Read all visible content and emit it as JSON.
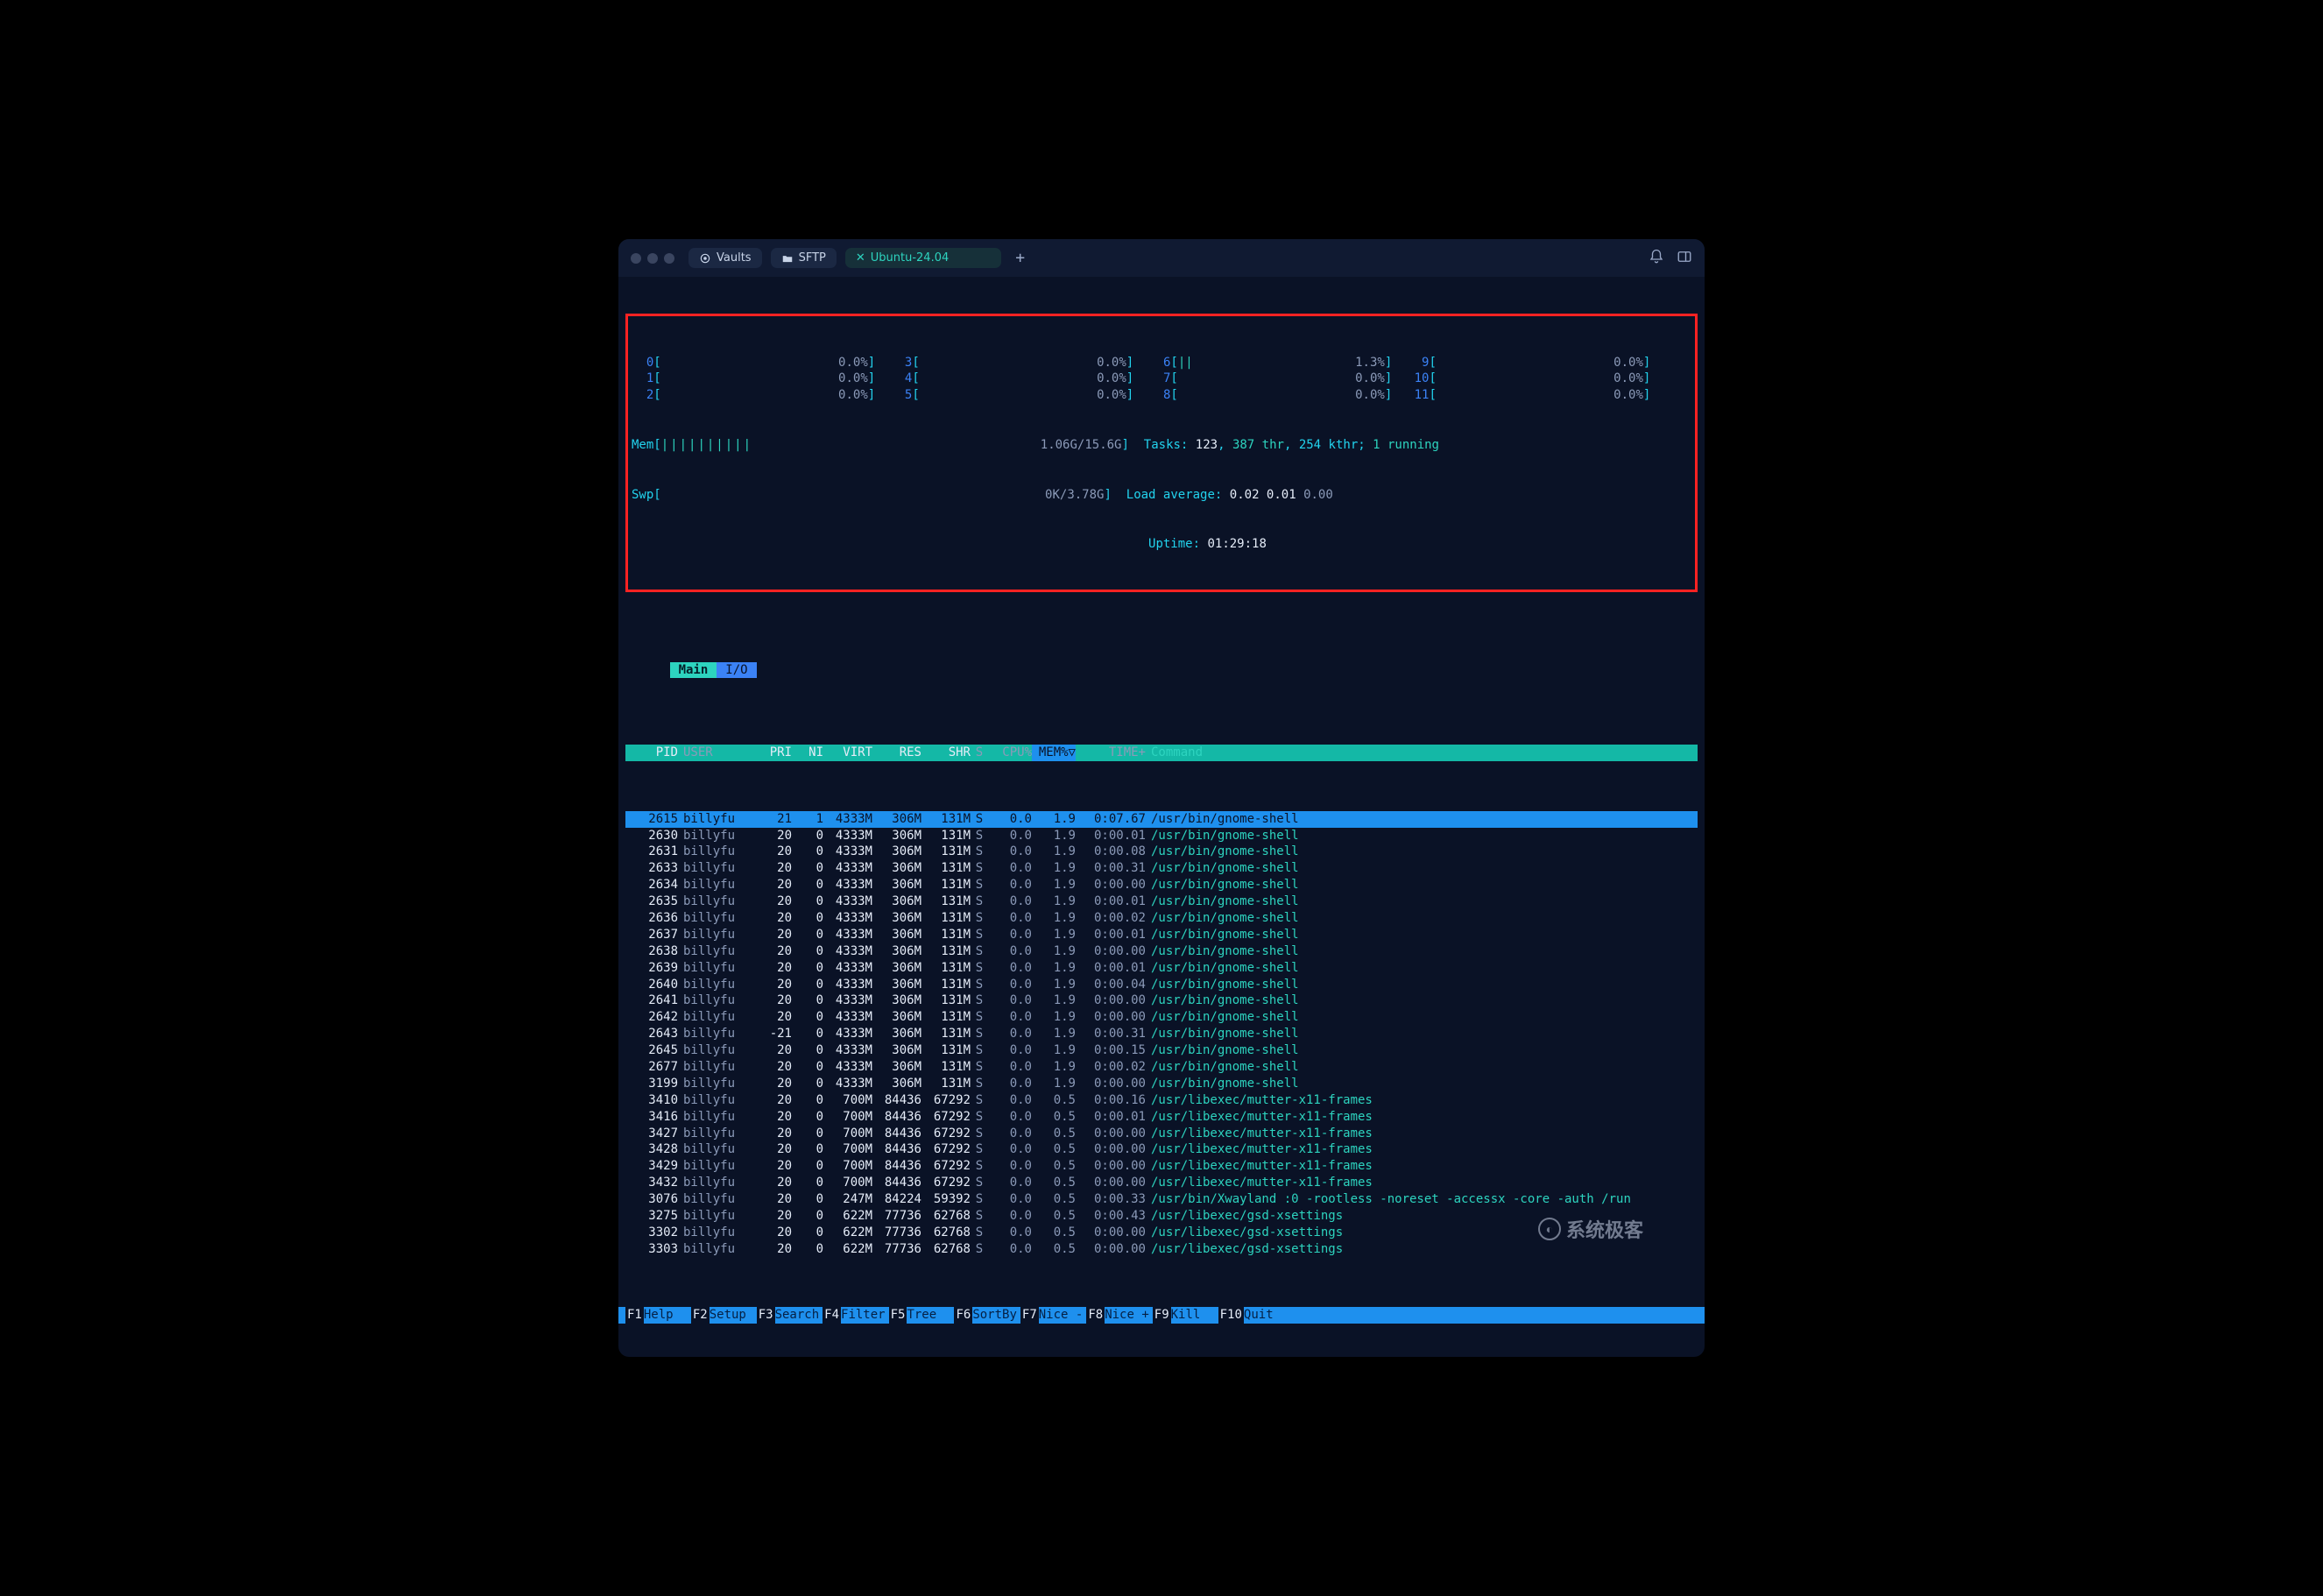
{
  "titlebar": {
    "pill1": "Vaults",
    "pill2": "SFTP",
    "tab_active_label": "Ubuntu-24.04",
    "plus": "+"
  },
  "meters": {
    "cpus": [
      {
        "id": "0",
        "bar": "",
        "pct": "0.0%"
      },
      {
        "id": "1",
        "bar": "",
        "pct": "0.0%"
      },
      {
        "id": "2",
        "bar": "",
        "pct": "0.0%"
      },
      {
        "id": "3",
        "bar": "",
        "pct": "0.0%"
      },
      {
        "id": "4",
        "bar": "",
        "pct": "0.0%"
      },
      {
        "id": "5",
        "bar": "",
        "pct": "0.0%"
      },
      {
        "id": "6",
        "bar": "||",
        "pct": "1.3%"
      },
      {
        "id": "7",
        "bar": "",
        "pct": "0.0%"
      },
      {
        "id": "8",
        "bar": "",
        "pct": "0.0%"
      },
      {
        "id": "9",
        "bar": "",
        "pct": "0.0%"
      },
      {
        "id": "10",
        "bar": "",
        "pct": "0.0%"
      },
      {
        "id": "11",
        "bar": "",
        "pct": "0.0%"
      }
    ],
    "mem_label": "Mem",
    "mem_bar": "||||||||||",
    "mem_text": "1.06G/15.6G",
    "swp_label": "Swp",
    "swp_text": "0K/3.78G",
    "tasks_label": "Tasks:",
    "tasks_total": "123",
    "tasks_thr": "387 thr",
    "tasks_kthr": "254 kthr;",
    "tasks_running": "1 running",
    "load_label": "Load average:",
    "load_vals": "0.02 0.01 0.00",
    "load_vals_extra": "0.00",
    "uptime_label": "Uptime:",
    "uptime_val": "01:29:18"
  },
  "tabs": {
    "main": "Main",
    "io": "I/O"
  },
  "headers": {
    "pid": "PID",
    "user": "USER",
    "pri": "PRI",
    "ni": "NI",
    "virt": "VIRT",
    "res": "RES",
    "shr": "SHR",
    "s": "S",
    "cpu": "CPU%",
    "mem": "MEM%▽",
    "time": "TIME+",
    "cmd": "Command"
  },
  "processes": [
    {
      "pid": "2615",
      "user": "billyfu",
      "pri": "21",
      "ni": "1",
      "virt": "4333M",
      "res": "306M",
      "shr": "131M",
      "s": "S",
      "cpu": "0.0",
      "mem": "1.9",
      "time": "0:07.67",
      "cmd": "/usr/bin/gnome-shell",
      "sel": true
    },
    {
      "pid": "2630",
      "user": "billyfu",
      "pri": "20",
      "ni": "0",
      "virt": "4333M",
      "res": "306M",
      "shr": "131M",
      "s": "S",
      "cpu": "0.0",
      "mem": "1.9",
      "time": "0:00.01",
      "cmd": "/usr/bin/gnome-shell"
    },
    {
      "pid": "2631",
      "user": "billyfu",
      "pri": "20",
      "ni": "0",
      "virt": "4333M",
      "res": "306M",
      "shr": "131M",
      "s": "S",
      "cpu": "0.0",
      "mem": "1.9",
      "time": "0:00.08",
      "cmd": "/usr/bin/gnome-shell"
    },
    {
      "pid": "2633",
      "user": "billyfu",
      "pri": "20",
      "ni": "0",
      "virt": "4333M",
      "res": "306M",
      "shr": "131M",
      "s": "S",
      "cpu": "0.0",
      "mem": "1.9",
      "time": "0:00.31",
      "cmd": "/usr/bin/gnome-shell"
    },
    {
      "pid": "2634",
      "user": "billyfu",
      "pri": "20",
      "ni": "0",
      "virt": "4333M",
      "res": "306M",
      "shr": "131M",
      "s": "S",
      "cpu": "0.0",
      "mem": "1.9",
      "time": "0:00.00",
      "cmd": "/usr/bin/gnome-shell"
    },
    {
      "pid": "2635",
      "user": "billyfu",
      "pri": "20",
      "ni": "0",
      "virt": "4333M",
      "res": "306M",
      "shr": "131M",
      "s": "S",
      "cpu": "0.0",
      "mem": "1.9",
      "time": "0:00.01",
      "cmd": "/usr/bin/gnome-shell"
    },
    {
      "pid": "2636",
      "user": "billyfu",
      "pri": "20",
      "ni": "0",
      "virt": "4333M",
      "res": "306M",
      "shr": "131M",
      "s": "S",
      "cpu": "0.0",
      "mem": "1.9",
      "time": "0:00.02",
      "cmd": "/usr/bin/gnome-shell"
    },
    {
      "pid": "2637",
      "user": "billyfu",
      "pri": "20",
      "ni": "0",
      "virt": "4333M",
      "res": "306M",
      "shr": "131M",
      "s": "S",
      "cpu": "0.0",
      "mem": "1.9",
      "time": "0:00.01",
      "cmd": "/usr/bin/gnome-shell"
    },
    {
      "pid": "2638",
      "user": "billyfu",
      "pri": "20",
      "ni": "0",
      "virt": "4333M",
      "res": "306M",
      "shr": "131M",
      "s": "S",
      "cpu": "0.0",
      "mem": "1.9",
      "time": "0:00.00",
      "cmd": "/usr/bin/gnome-shell"
    },
    {
      "pid": "2639",
      "user": "billyfu",
      "pri": "20",
      "ni": "0",
      "virt": "4333M",
      "res": "306M",
      "shr": "131M",
      "s": "S",
      "cpu": "0.0",
      "mem": "1.9",
      "time": "0:00.01",
      "cmd": "/usr/bin/gnome-shell"
    },
    {
      "pid": "2640",
      "user": "billyfu",
      "pri": "20",
      "ni": "0",
      "virt": "4333M",
      "res": "306M",
      "shr": "131M",
      "s": "S",
      "cpu": "0.0",
      "mem": "1.9",
      "time": "0:00.04",
      "cmd": "/usr/bin/gnome-shell"
    },
    {
      "pid": "2641",
      "user": "billyfu",
      "pri": "20",
      "ni": "0",
      "virt": "4333M",
      "res": "306M",
      "shr": "131M",
      "s": "S",
      "cpu": "0.0",
      "mem": "1.9",
      "time": "0:00.00",
      "cmd": "/usr/bin/gnome-shell"
    },
    {
      "pid": "2642",
      "user": "billyfu",
      "pri": "20",
      "ni": "0",
      "virt": "4333M",
      "res": "306M",
      "shr": "131M",
      "s": "S",
      "cpu": "0.0",
      "mem": "1.9",
      "time": "0:00.00",
      "cmd": "/usr/bin/gnome-shell"
    },
    {
      "pid": "2643",
      "user": "billyfu",
      "pri": "-21",
      "ni": "0",
      "virt": "4333M",
      "res": "306M",
      "shr": "131M",
      "s": "S",
      "cpu": "0.0",
      "mem": "1.9",
      "time": "0:00.31",
      "cmd": "/usr/bin/gnome-shell"
    },
    {
      "pid": "2645",
      "user": "billyfu",
      "pri": "20",
      "ni": "0",
      "virt": "4333M",
      "res": "306M",
      "shr": "131M",
      "s": "S",
      "cpu": "0.0",
      "mem": "1.9",
      "time": "0:00.15",
      "cmd": "/usr/bin/gnome-shell"
    },
    {
      "pid": "2677",
      "user": "billyfu",
      "pri": "20",
      "ni": "0",
      "virt": "4333M",
      "res": "306M",
      "shr": "131M",
      "s": "S",
      "cpu": "0.0",
      "mem": "1.9",
      "time": "0:00.02",
      "cmd": "/usr/bin/gnome-shell"
    },
    {
      "pid": "3199",
      "user": "billyfu",
      "pri": "20",
      "ni": "0",
      "virt": "4333M",
      "res": "306M",
      "shr": "131M",
      "s": "S",
      "cpu": "0.0",
      "mem": "1.9",
      "time": "0:00.00",
      "cmd": "/usr/bin/gnome-shell"
    },
    {
      "pid": "3410",
      "user": "billyfu",
      "pri": "20",
      "ni": "0",
      "virt": "700M",
      "res": "84436",
      "shr": "67292",
      "s": "S",
      "cpu": "0.0",
      "mem": "0.5",
      "time": "0:00.16",
      "cmd": "/usr/libexec/mutter-x11-frames"
    },
    {
      "pid": "3416",
      "user": "billyfu",
      "pri": "20",
      "ni": "0",
      "virt": "700M",
      "res": "84436",
      "shr": "67292",
      "s": "S",
      "cpu": "0.0",
      "mem": "0.5",
      "time": "0:00.01",
      "cmd": "/usr/libexec/mutter-x11-frames"
    },
    {
      "pid": "3427",
      "user": "billyfu",
      "pri": "20",
      "ni": "0",
      "virt": "700M",
      "res": "84436",
      "shr": "67292",
      "s": "S",
      "cpu": "0.0",
      "mem": "0.5",
      "time": "0:00.00",
      "cmd": "/usr/libexec/mutter-x11-frames"
    },
    {
      "pid": "3428",
      "user": "billyfu",
      "pri": "20",
      "ni": "0",
      "virt": "700M",
      "res": "84436",
      "shr": "67292",
      "s": "S",
      "cpu": "0.0",
      "mem": "0.5",
      "time": "0:00.00",
      "cmd": "/usr/libexec/mutter-x11-frames"
    },
    {
      "pid": "3429",
      "user": "billyfu",
      "pri": "20",
      "ni": "0",
      "virt": "700M",
      "res": "84436",
      "shr": "67292",
      "s": "S",
      "cpu": "0.0",
      "mem": "0.5",
      "time": "0:00.00",
      "cmd": "/usr/libexec/mutter-x11-frames"
    },
    {
      "pid": "3432",
      "user": "billyfu",
      "pri": "20",
      "ni": "0",
      "virt": "700M",
      "res": "84436",
      "shr": "67292",
      "s": "S",
      "cpu": "0.0",
      "mem": "0.5",
      "time": "0:00.00",
      "cmd": "/usr/libexec/mutter-x11-frames"
    },
    {
      "pid": "3076",
      "user": "billyfu",
      "pri": "20",
      "ni": "0",
      "virt": "247M",
      "res": "84224",
      "shr": "59392",
      "s": "S",
      "cpu": "0.0",
      "mem": "0.5",
      "time": "0:00.33",
      "cmd": "/usr/bin/Xwayland :0 -rootless -noreset -accessx -core -auth /run"
    },
    {
      "pid": "3275",
      "user": "billyfu",
      "pri": "20",
      "ni": "0",
      "virt": "622M",
      "res": "77736",
      "shr": "62768",
      "s": "S",
      "cpu": "0.0",
      "mem": "0.5",
      "time": "0:00.43",
      "cmd": "/usr/libexec/gsd-xsettings"
    },
    {
      "pid": "3302",
      "user": "billyfu",
      "pri": "20",
      "ni": "0",
      "virt": "622M",
      "res": "77736",
      "shr": "62768",
      "s": "S",
      "cpu": "0.0",
      "mem": "0.5",
      "time": "0:00.00",
      "cmd": "/usr/libexec/gsd-xsettings"
    },
    {
      "pid": "3303",
      "user": "billyfu",
      "pri": "20",
      "ni": "0",
      "virt": "622M",
      "res": "77736",
      "shr": "62768",
      "s": "S",
      "cpu": "0.0",
      "mem": "0.5",
      "time": "0:00.00",
      "cmd": "/usr/libexec/gsd-xsettings"
    }
  ],
  "fnbar": [
    {
      "key": "F1",
      "label": "Help"
    },
    {
      "key": "F2",
      "label": "Setup"
    },
    {
      "key": "F3",
      "label": "Search"
    },
    {
      "key": "F4",
      "label": "Filter"
    },
    {
      "key": "F5",
      "label": "Tree"
    },
    {
      "key": "F6",
      "label": "SortBy"
    },
    {
      "key": "F7",
      "label": "Nice -"
    },
    {
      "key": "F8",
      "label": "Nice +"
    },
    {
      "key": "F9",
      "label": "Kill"
    },
    {
      "key": "F10",
      "label": "Quit"
    }
  ],
  "watermark": "系统极客"
}
